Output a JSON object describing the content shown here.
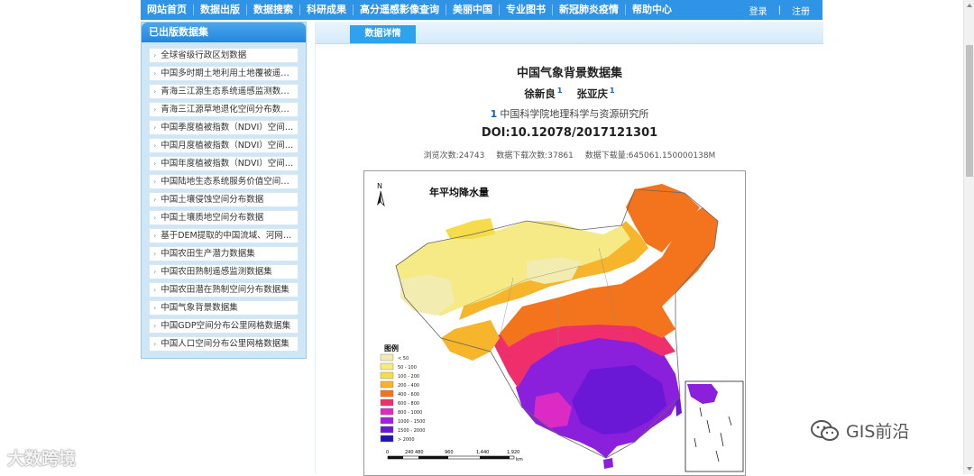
{
  "nav": {
    "items": [
      "网站首页",
      "数据出版",
      "数据搜索",
      "科研成果",
      "高分遥感影像查询",
      "美丽中国",
      "专业图书",
      "新冠肺炎疫情",
      "帮助中心"
    ],
    "login": "登录",
    "separator": "|",
    "register": "注册"
  },
  "sidebar": {
    "title": "已出版数据集",
    "items": [
      "全球省级行政区划数据",
      "中国多时期土地利用土地覆被遥感监测数据集",
      "青海三江源生态系统遥感监测数据集",
      "青海三江源草地退化空间分布数据集",
      "中国季度植被指数（NDVI）空间分布数据集",
      "中国月度植被指数（NDVI）空间分布数据集",
      "中国年度植被指数（NDVI）空间分布数据集",
      "中国陆地生态系统服务价值空间分布数据集",
      "中国土壤侵蚀空间分布数据",
      "中国土壤质地空间分布数据",
      "基于DEM提取的中国流域、河网数据集",
      "中国农田生产潜力数据集",
      "中国农田熟制遥感监测数据集",
      "中国农田潜在熟制空间分布数据集",
      "中国气象背景数据集",
      "中国GDP空间分布公里网格数据集",
      "中国人口空间分布公里网格数据集"
    ]
  },
  "main": {
    "tab": "数据详情",
    "title": "中国气象背景数据集",
    "authors": [
      {
        "name": "徐新良",
        "sup": "1"
      },
      {
        "name": "张亚庆",
        "sup": "1"
      }
    ],
    "affiliation_num": "1",
    "affiliation": "中国科学院地理科学与资源研究所",
    "doi": "DOI:10.12078/2017121301",
    "stats": {
      "views": "浏览次数:24743",
      "downloads": "数据下载次数:37861",
      "volume": "数据下载量:645061.150000138M"
    }
  },
  "map": {
    "title": "年平均降水量",
    "north": "N",
    "legend_title": "图例",
    "legend": [
      {
        "label": "< 50",
        "color": "#f2ecb0"
      },
      {
        "label": "50 - 100",
        "color": "#f5ea85"
      },
      {
        "label": "100 - 200",
        "color": "#f6dc4b"
      },
      {
        "label": "200 - 400",
        "color": "#f6b52a"
      },
      {
        "label": "400 - 600",
        "color": "#f4741e"
      },
      {
        "label": "600 - 800",
        "color": "#ee2f6b"
      },
      {
        "label": "800 - 1000",
        "color": "#dc2ac4"
      },
      {
        "label": "1000 - 1500",
        "color": "#a21ee0"
      },
      {
        "label": "1500 - 2000",
        "color": "#6b18d6"
      },
      {
        "label": "> 2000",
        "color": "#2212b8"
      }
    ],
    "scale_labels": [
      "0",
      "240",
      "480",
      "960",
      "1,440",
      "1,920"
    ],
    "scale_unit": "km"
  },
  "watermarks": {
    "left": "大数跨境",
    "right": "GIS前沿"
  }
}
